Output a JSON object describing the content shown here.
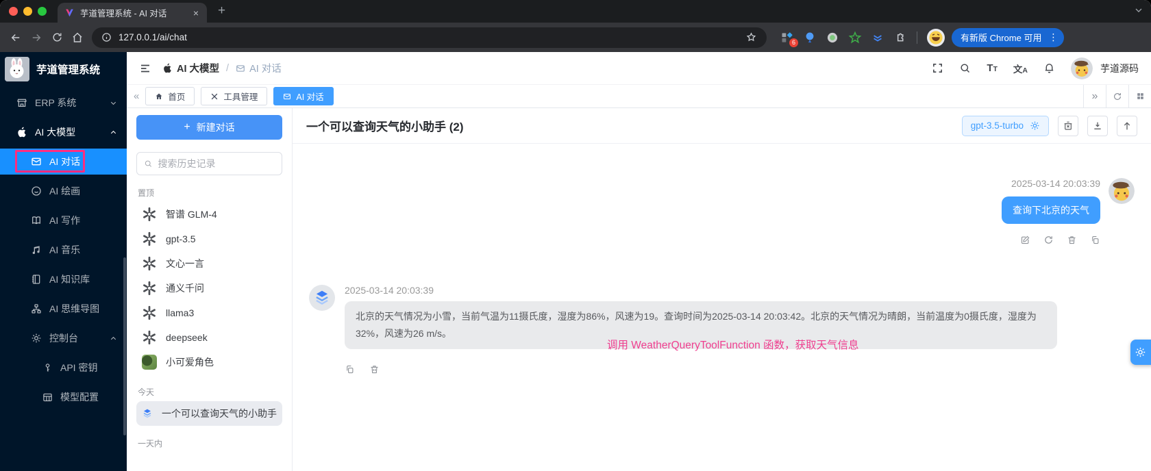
{
  "colors": {
    "accent": "#409eff",
    "sidebar_active": "#1890ff",
    "annotation_pink": "#ef3f8f",
    "sidebar_bg": "#001529",
    "chrome_update_blue": "#1967d2"
  },
  "browser": {
    "tab_title": "芋道管理系统 - AI 对话",
    "url": "127.0.0.1/ai/chat",
    "update_button": "有新版 Chrome 可用",
    "extension_badge": "6"
  },
  "sidebar": {
    "app_title": "芋道管理系统",
    "items": [
      {
        "label": "ERP 系统"
      },
      {
        "label": "AI 大模型"
      },
      {
        "label": "AI 对话"
      },
      {
        "label": "AI 绘画"
      },
      {
        "label": "AI 写作"
      },
      {
        "label": "AI 音乐"
      },
      {
        "label": "AI 知识库"
      },
      {
        "label": "AI 思维导图"
      },
      {
        "label": "控制台"
      },
      {
        "label": "API 密钥"
      },
      {
        "label": "模型配置"
      }
    ]
  },
  "header": {
    "breadcrumb": {
      "parent": "AI 大模型",
      "sep": "/",
      "current": "AI 对话"
    },
    "username": "芋道源码",
    "font_icon": "TT",
    "translate_icon_cn": "文",
    "translate_icon_en": "A"
  },
  "pagetabs": [
    {
      "label": "首页"
    },
    {
      "label": "工具管理"
    },
    {
      "label": "AI 对话"
    }
  ],
  "chatlist": {
    "new_chat": "新建对话",
    "search_placeholder": "搜索历史记录",
    "section_pinned": "置顶",
    "section_today": "今天",
    "section_older": "一天内",
    "pinned": [
      {
        "label": "智谱 GLM-4"
      },
      {
        "label": "gpt-3.5"
      },
      {
        "label": "文心一言"
      },
      {
        "label": "通义千问"
      },
      {
        "label": "llama3"
      },
      {
        "label": "deepseek"
      },
      {
        "label": "小可爱角色"
      }
    ],
    "today": [
      {
        "label": "一个可以查询天气的小助手"
      }
    ]
  },
  "chat": {
    "title": "一个可以查询天气的小助手 (2)",
    "model": "gpt-3.5-turbo",
    "user_message": {
      "time": "2025-03-14 20:03:39",
      "text": "查询下北京的天气"
    },
    "ai_message": {
      "time": "2025-03-14 20:03:39",
      "text": "北京的天气情况为小雪，当前气温为11摄氏度，湿度为86%，风速为19。查询时间为2025-03-14 20:03:42。北京的天气情况为晴朗，当前温度为0摄氏度，湿度为32%，风速为26 m/s。"
    },
    "annotation": "调用 WeatherQueryToolFunction 函数，获取天气信息"
  }
}
